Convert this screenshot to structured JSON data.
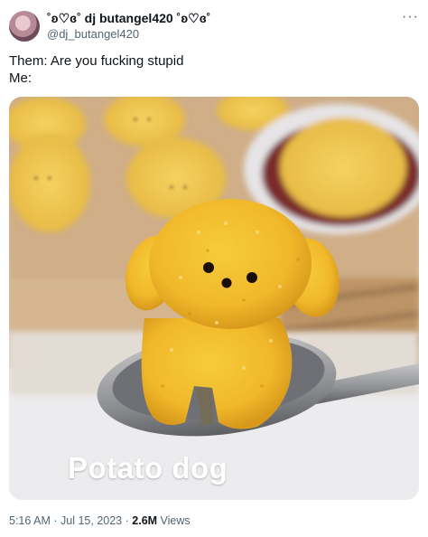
{
  "author": {
    "display_name": "˚ʚ♡ɞ˚ dj butangel420 ˚ʚ♡ɞ˚",
    "handle": "@dj_butangel420",
    "more_icon": "more-horizontal-icon"
  },
  "tweet": {
    "line1": "Them: Are you fucking stupid",
    "line2": "Me:"
  },
  "media": {
    "caption": "Potato dog"
  },
  "meta": {
    "time": "5:16 AM",
    "separator": "·",
    "date": "Jul 15, 2023",
    "views_count": "2.6M",
    "views_label": "Views"
  }
}
